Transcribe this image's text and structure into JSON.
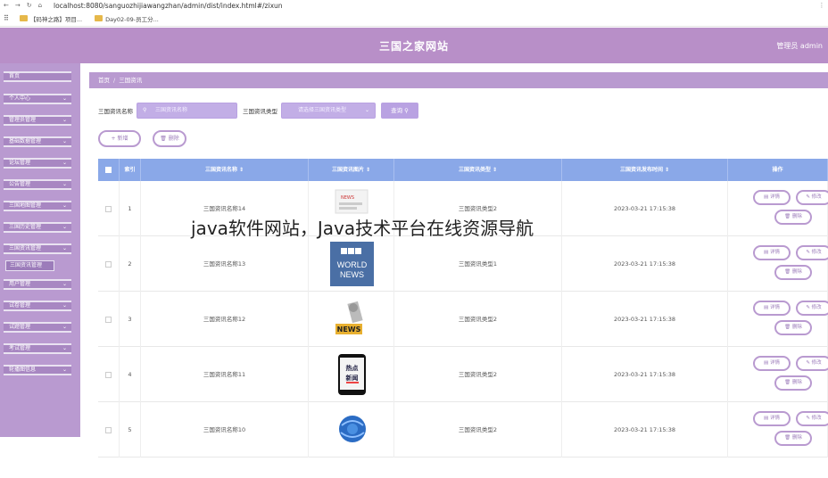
{
  "browser": {
    "url": "localhost:8080/sanguozhijiawangzhan/admin/dist/index.html#/zixun",
    "nav": [
      "←",
      "→",
      "↻",
      "⌂"
    ],
    "menu": "⋮"
  },
  "bookmarks": [
    {
      "label": "【码神之路】项目..."
    },
    {
      "label": "Day02-09-员工分..."
    }
  ],
  "header": {
    "title": "三国之家网站",
    "admin": "管理员 admin"
  },
  "sidebar": {
    "items": [
      {
        "label": "首页",
        "has_arrow": false
      },
      {
        "label": "个人中心",
        "has_arrow": true
      },
      {
        "label": "管理员管理",
        "has_arrow": true
      },
      {
        "label": "基础数据管理",
        "has_arrow": true
      },
      {
        "label": "论坛管理",
        "has_arrow": true
      },
      {
        "label": "公告管理",
        "has_arrow": true
      },
      {
        "label": "三国地图管理",
        "has_arrow": true
      },
      {
        "label": "三国历史管理",
        "has_arrow": true
      },
      {
        "label": "三国资讯管理",
        "has_arrow": true
      },
      {
        "label": "三国资讯管理",
        "has_arrow": false,
        "sub": true
      },
      {
        "label": "用户管理",
        "has_arrow": true
      },
      {
        "label": "试卷管理",
        "has_arrow": true
      },
      {
        "label": "试题管理",
        "has_arrow": true
      },
      {
        "label": "考试管理",
        "has_arrow": true
      },
      {
        "label": "轮播图信息",
        "has_arrow": true
      }
    ]
  },
  "breadcrumb": {
    "home": "首页",
    "sep": "/",
    "current": "三国资讯"
  },
  "search": {
    "name_label": "三国资讯名称",
    "name_placeholder": "三国资讯名称",
    "type_label": "三国资讯类型",
    "type_placeholder": "请选择三国资讯类型",
    "button": "查询 ⚲"
  },
  "actions": {
    "add": "+ 新增",
    "delete": "🗑 删除"
  },
  "table": {
    "columns": [
      "",
      "索引",
      "三国资讯名称 ⇕",
      "三国资讯图片 ⇕",
      "三国资讯类型 ⇕",
      "三国资讯发布时间 ⇕",
      "操作"
    ],
    "rows": [
      {
        "index": "1",
        "name": "三国资讯名称14",
        "type": "三国资讯类型2",
        "time": "2023-03-21 17:15:38"
      },
      {
        "index": "2",
        "name": "三国资讯名称13",
        "type": "三国资讯类型1",
        "time": "2023-03-21 17:15:38"
      },
      {
        "index": "3",
        "name": "三国资讯名称12",
        "type": "三国资讯类型2",
        "time": "2023-03-21 17:15:38"
      },
      {
        "index": "4",
        "name": "三国资讯名称11",
        "type": "三国资讯类型2",
        "time": "2023-03-21 17:15:38"
      },
      {
        "index": "5",
        "name": "三国资讯名称10",
        "type": "三国资讯类型2",
        "time": "2023-03-21 17:15:38"
      }
    ],
    "row_actions": {
      "detail": "▤ 详情",
      "edit": "✎ 修改",
      "delete": "🗑 删除"
    }
  },
  "overlay_caption": "java软件网站，Java技术平台在线资源导航",
  "colors": {
    "header": "#b88fc8",
    "sidebar": "#b99ad0",
    "table_head": "#8aa8e8",
    "accent": "#9c7cba"
  }
}
